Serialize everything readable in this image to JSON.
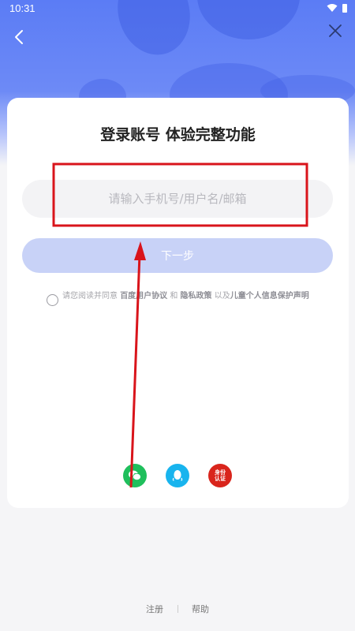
{
  "status_bar": {
    "time": "10:31"
  },
  "login": {
    "title": "登录账号 体验完整功能",
    "input_placeholder": "请输入手机号/用户名/邮箱",
    "next_label": "下一步"
  },
  "agreement": {
    "prefix": "请您阅读并同意 ",
    "user_agreement": "百度用户协议",
    "and": " 和 ",
    "privacy": "隐私政策",
    "and_also": " 以及",
    "child_privacy": "儿童个人信息保护声明"
  },
  "social": {
    "identity_label": "身份认证"
  },
  "footer": {
    "register": "注册",
    "help": "帮助"
  },
  "colors": {
    "accent": "#5b7cf5",
    "button": "#c8d2f7",
    "annotation_red": "#d9141b",
    "wechat": "#1fbf5c",
    "qq": "#18b4ee",
    "identity": "#d9251c"
  }
}
